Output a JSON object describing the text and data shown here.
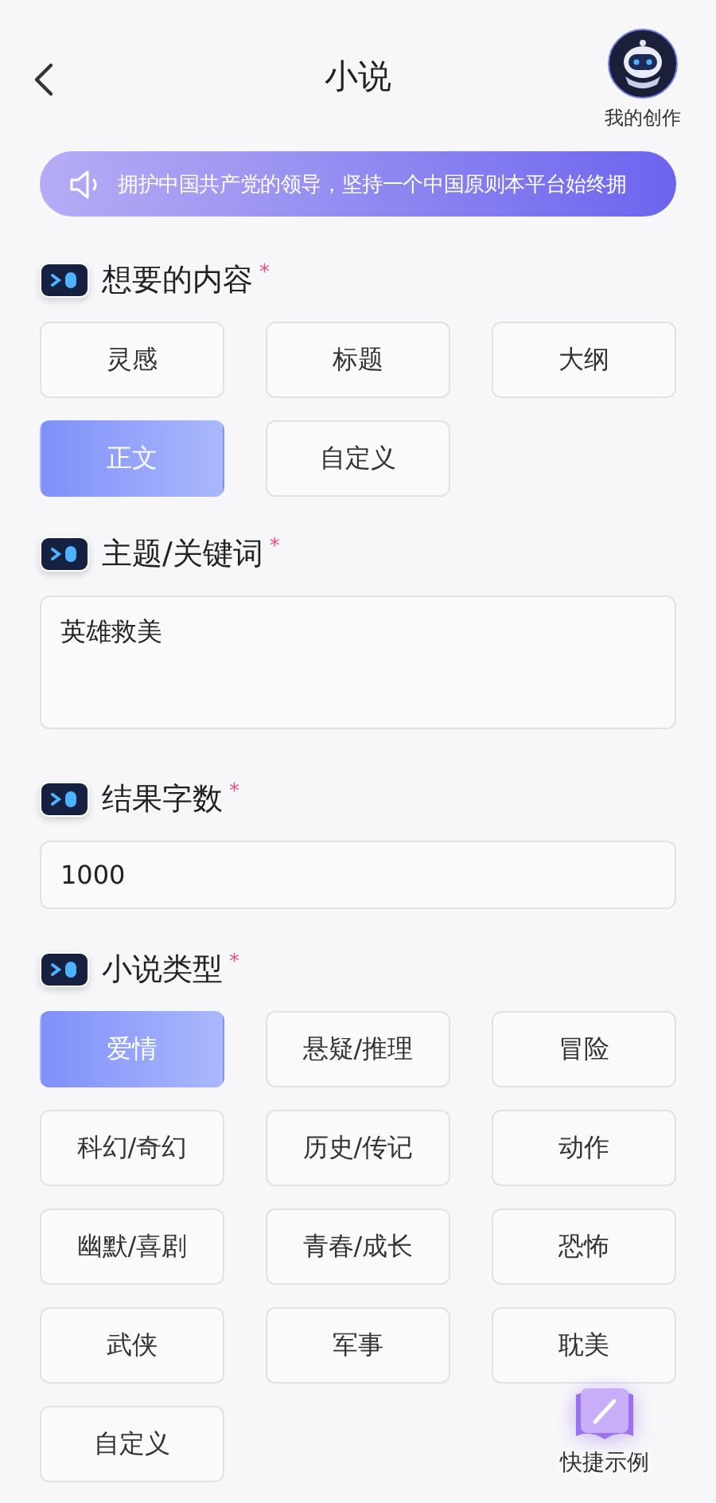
{
  "header": {
    "title": "小说",
    "profile_label": "我的创作"
  },
  "notice": {
    "text": "拥护中国共产党的领导，坚持一个中国原则本平台始终拥"
  },
  "sections": [
    {
      "kind": "chips",
      "title": "想要的内容",
      "required_mark": "*",
      "options": [
        {
          "label": "灵感",
          "selected": false
        },
        {
          "label": "标题",
          "selected": false
        },
        {
          "label": "大纲",
          "selected": false
        },
        {
          "label": "正文",
          "selected": true
        },
        {
          "label": "自定义",
          "selected": false
        }
      ]
    },
    {
      "kind": "textarea",
      "title": "主题/关键词",
      "required_mark": "*",
      "value": "英雄救美"
    },
    {
      "kind": "input",
      "title": "结果字数",
      "required_mark": "*",
      "value": "1000"
    },
    {
      "kind": "chips",
      "title": "小说类型",
      "required_mark": "*",
      "options": [
        {
          "label": "爱情",
          "selected": true
        },
        {
          "label": "悬疑/推理",
          "selected": false
        },
        {
          "label": "冒险",
          "selected": false
        },
        {
          "label": "科幻/奇幻",
          "selected": false
        },
        {
          "label": "历史/传记",
          "selected": false
        },
        {
          "label": "动作",
          "selected": false
        },
        {
          "label": "幽默/喜剧",
          "selected": false
        },
        {
          "label": "青春/成长",
          "selected": false
        },
        {
          "label": "恐怖",
          "selected": false
        },
        {
          "label": "武侠",
          "selected": false
        },
        {
          "label": "军事",
          "selected": false
        },
        {
          "label": "耽美",
          "selected": false
        },
        {
          "label": "自定义",
          "selected": false
        }
      ]
    }
  ],
  "fab": {
    "label": "快捷示例"
  }
}
